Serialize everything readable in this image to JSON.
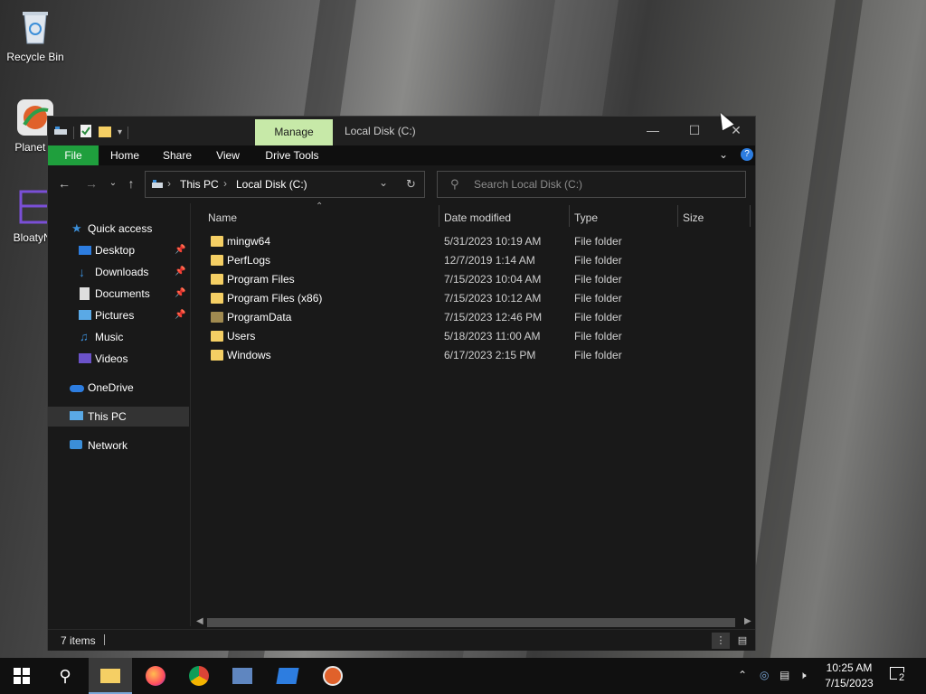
{
  "desktop": {
    "icons": [
      {
        "label": "Recycle Bin",
        "icon": "recycle-bin-icon"
      },
      {
        "label": "Planet V",
        "icon": "planet-app-icon"
      },
      {
        "label": "BloatyNo",
        "icon": "bloaty-app-icon"
      }
    ]
  },
  "window": {
    "title": "Local Disk (C:)",
    "contextual_tab": "Manage",
    "ribbon_tabs": [
      "File",
      "Home",
      "Share",
      "View",
      "Drive Tools"
    ],
    "colors": {
      "file_tab": "#1f9f3d",
      "manage_tab": "#c7e9a8",
      "accent": "#2d7de0",
      "folder": "#f5cf64"
    }
  },
  "address": {
    "crumbs": [
      "This PC",
      "Local Disk (C:)"
    ]
  },
  "search": {
    "placeholder": "Search Local Disk (C:)"
  },
  "sidebar": {
    "items": [
      {
        "label": "Quick access",
        "icon": "star-icon",
        "pinned": false
      },
      {
        "label": "Desktop",
        "icon": "desktop-icon",
        "pinned": true
      },
      {
        "label": "Downloads",
        "icon": "download-icon",
        "pinned": true
      },
      {
        "label": "Documents",
        "icon": "documents-icon",
        "pinned": true
      },
      {
        "label": "Pictures",
        "icon": "pictures-icon",
        "pinned": true
      },
      {
        "label": "Music",
        "icon": "music-icon",
        "pinned": false
      },
      {
        "label": "Videos",
        "icon": "videos-icon",
        "pinned": false
      },
      {
        "label": "OneDrive",
        "icon": "cloud-icon",
        "pinned": false
      },
      {
        "label": "This PC",
        "icon": "computer-icon",
        "pinned": false,
        "selected": true
      },
      {
        "label": "Network",
        "icon": "network-icon",
        "pinned": false
      }
    ]
  },
  "columns": [
    "Name",
    "Date modified",
    "Type",
    "Size"
  ],
  "files": [
    {
      "name": "mingw64",
      "date": "5/31/2023 10:19 AM",
      "type": "File folder"
    },
    {
      "name": "PerfLogs",
      "date": "12/7/2019 1:14 AM",
      "type": "File folder"
    },
    {
      "name": "Program Files",
      "date": "7/15/2023 10:04 AM",
      "type": "File folder"
    },
    {
      "name": "Program Files (x86)",
      "date": "7/15/2023 10:12 AM",
      "type": "File folder"
    },
    {
      "name": "ProgramData",
      "date": "7/15/2023 12:46 PM",
      "type": "File folder"
    },
    {
      "name": "Users",
      "date": "5/18/2023 11:00 AM",
      "type": "File folder"
    },
    {
      "name": "Windows",
      "date": "6/17/2023 2:15 PM",
      "type": "File folder"
    }
  ],
  "status": {
    "count": "7 items"
  },
  "taskbar": {
    "apps": [
      "start-icon",
      "search-icon",
      "file-explorer-icon",
      "firefox-icon",
      "chrome-icon",
      "network-tool-icon",
      "remote-desktop-icon",
      "planet-app-icon"
    ],
    "time": "10:25 AM",
    "date": "7/15/2023",
    "notifications": "2"
  }
}
